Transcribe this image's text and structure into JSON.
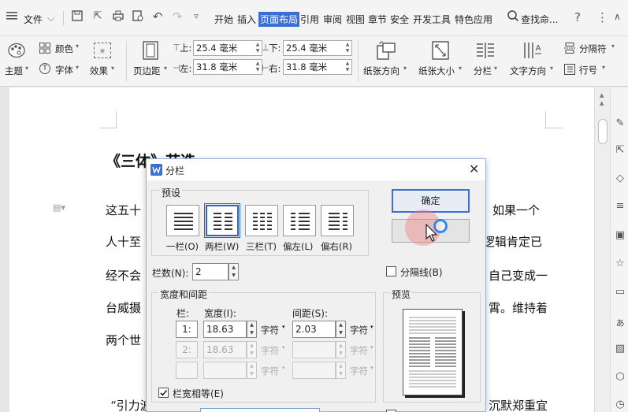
{
  "menubar": {
    "file_label": "文件",
    "tabs": [
      {
        "label": "开始"
      },
      {
        "label": "插入"
      },
      {
        "label": "页面布局"
      },
      {
        "label": "引用"
      },
      {
        "label": "审阅"
      },
      {
        "label": "视图"
      },
      {
        "label": "章节"
      },
      {
        "label": "安全"
      },
      {
        "label": "开发工具"
      },
      {
        "label": "特色应用"
      }
    ],
    "search_label": "查找命...",
    "help_glyph": "?",
    "more_glyph": "⋮"
  },
  "ribbon": {
    "theme_label": "主题",
    "color_label": "颜色",
    "font_label": "字体",
    "effect_label": "效果",
    "margins_label": "页边距",
    "top_label": "上:",
    "top_value": "25.4 毫米",
    "bottom_label": "下:",
    "bottom_value": "25.4 毫米",
    "left_label": "左:",
    "left_value": "31.8 毫米",
    "right_label": "右:",
    "right_value": "31.8 毫米",
    "orientation_label": "纸张方向",
    "size_label": "纸张大小",
    "columns_label": "分栏",
    "text_direction_label": "文字方向",
    "separator_label": "分隔符",
    "line_number_label": "行号"
  },
  "document": {
    "heading": "《三体》节选",
    "lines": [
      "这五十",
      "人十至",
      "经不会",
      "台威摄",
      "两个世",
      "“引力波"
    ],
    "right_fragments": [
      "如果一个",
      "逻辑肯定已",
      "自己变成一",
      "霄。维持着",
      "沉默郑重宜"
    ]
  },
  "dialog": {
    "title": "分栏",
    "presets_label": "预设",
    "presets": [
      {
        "label": "一栏(O)"
      },
      {
        "label": "两栏(W)"
      },
      {
        "label": "三栏(T)"
      },
      {
        "label": "偏左(L)"
      },
      {
        "label": "偏右(R)"
      }
    ],
    "count_label": "栏数(N):",
    "count_value": "2",
    "separator_label": "分隔线(B)",
    "width_spacing_label": "宽度和间距",
    "col_header": "栏:",
    "width_header": "宽度(I):",
    "spacing_header": "间距(S):",
    "rows": [
      {
        "index": "1:",
        "width": "18.63",
        "spacing": "2.03",
        "unit": "字符"
      },
      {
        "index": "2:",
        "width": "18.63",
        "spacing": "",
        "unit": "字符"
      },
      {
        "index": "",
        "width": "",
        "spacing": "",
        "unit": "字符"
      }
    ],
    "equal_width_label": "栏宽相等(E)",
    "preview_label": "预览",
    "ok_label": "确定"
  },
  "colors": {
    "accent": "#3b6fd6",
    "dialog_border": "#9ab0d8"
  }
}
